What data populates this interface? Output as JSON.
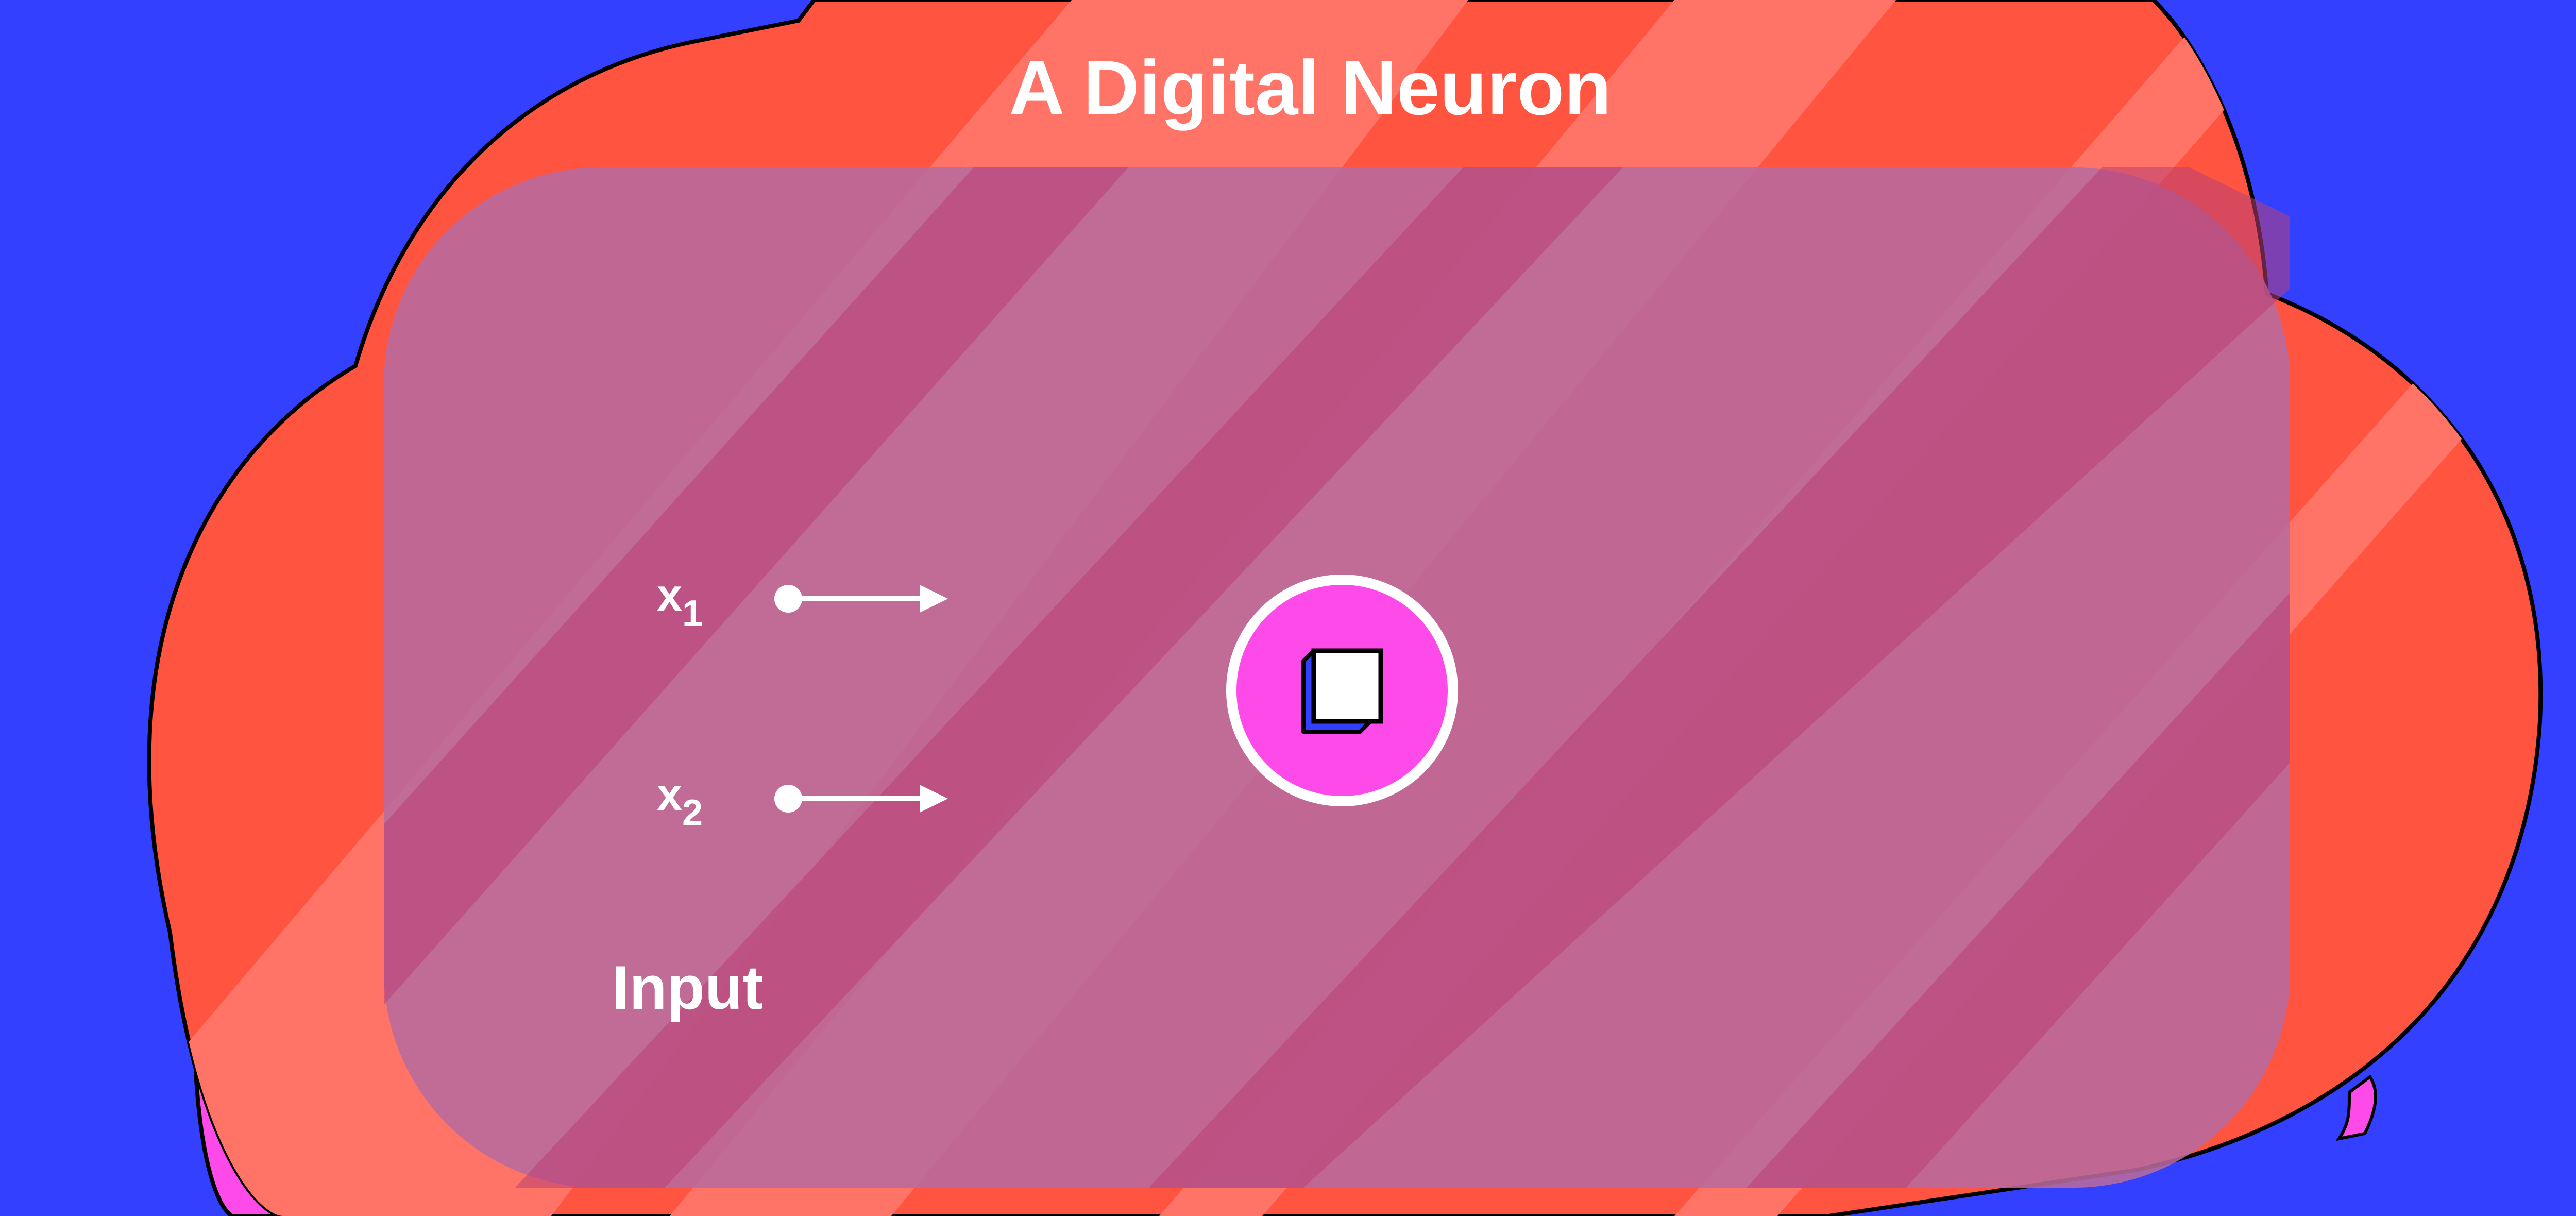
{
  "title": "A Digital Neuron",
  "inputs": [
    {
      "name": "x",
      "subscript": "1"
    },
    {
      "name": "x",
      "subscript": "2"
    }
  ],
  "input_section_label": "Input",
  "neuron_icon": "cube-icon",
  "colors": {
    "background": "#3340FF",
    "cloud": "#FF5540",
    "cloud_light_band": "#FF7466",
    "panel": "#B86A9E",
    "panel_opacity": 0.85,
    "neuron": "#FF4AEA",
    "pink_accent": "#FF4AEA",
    "white": "#FFFFFF",
    "outline": "#000000",
    "cube_side": "#3340FF"
  }
}
